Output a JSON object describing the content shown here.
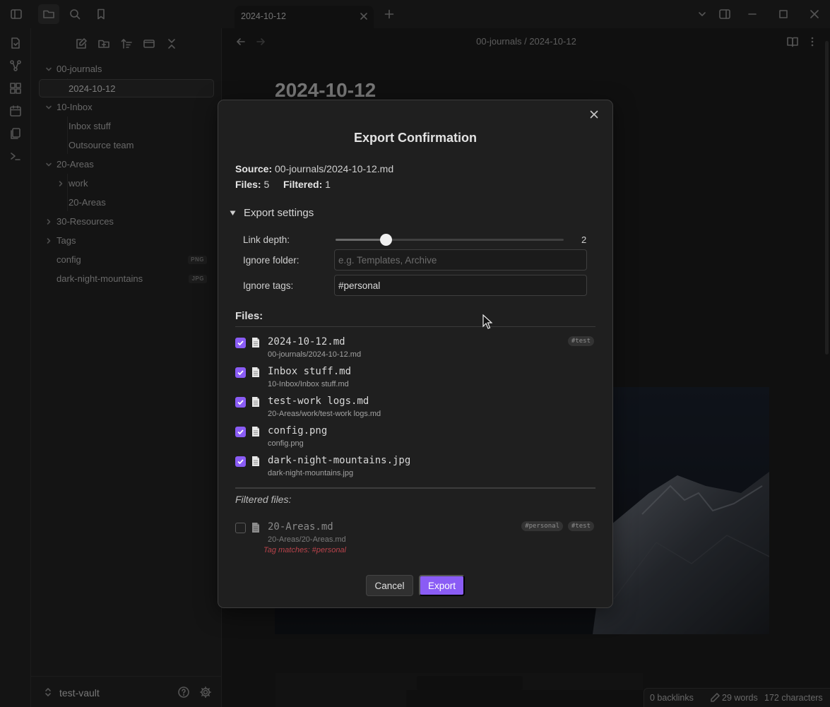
{
  "app": {
    "accent": "#8a5cf5"
  },
  "titlebar": {
    "tab_title": "2024-10-12",
    "icons": [
      "sidebar-toggle-icon",
      "folder-icon",
      "search-icon",
      "bookmark-icon",
      "close-icon",
      "plus-icon",
      "chevron-down-icon",
      "right-sidebar-icon",
      "minimize-icon",
      "maximize-icon",
      "close-icon"
    ]
  },
  "ribbon": {
    "icons": [
      "file-switcher-icon",
      "graph-icon",
      "canvas-icon",
      "calendar-icon",
      "templates-icon",
      "terminal-icon"
    ]
  },
  "sidebar": {
    "toolbar_icons": [
      "new-note-icon",
      "new-folder-icon",
      "sort-icon",
      "collapse-icon",
      "close-all-icon"
    ],
    "tree": [
      {
        "label": "00-journals",
        "type": "folder",
        "expanded": true
      },
      {
        "label": "2024-10-12",
        "type": "file",
        "selected": true
      },
      {
        "label": "10-Inbox",
        "type": "folder",
        "expanded": true
      },
      {
        "label": "Inbox stuff",
        "type": "file"
      },
      {
        "label": "Outsource team",
        "type": "file"
      },
      {
        "label": "20-Areas",
        "type": "folder",
        "expanded": true
      },
      {
        "label": "work",
        "type": "folder",
        "expanded": false
      },
      {
        "label": "20-Areas",
        "type": "file"
      },
      {
        "label": "30-Resources",
        "type": "folder",
        "expanded": false
      },
      {
        "label": "Tags",
        "type": "folder",
        "expanded": false
      },
      {
        "label": "config",
        "type": "file",
        "badge": "PNG"
      },
      {
        "label": "dark-night-mountains",
        "type": "file",
        "badge": "JPG"
      }
    ],
    "vault_name": "test-vault"
  },
  "main": {
    "breadcrumb": "00-journals / 2024-10-12",
    "note_title": "2024-10-12",
    "status": {
      "backlinks": "0 backlinks",
      "words": "29 words",
      "characters": "172 characters"
    }
  },
  "modal": {
    "title": "Export Confirmation",
    "source_label": "Source:",
    "source_value": "00-journals/2024-10-12.md",
    "files_label": "Files:",
    "files_count": "5",
    "filtered_label": "Filtered:",
    "filtered_count": "1",
    "settings_toggle": "Export settings",
    "link_depth_label": "Link depth:",
    "link_depth_value": "2",
    "link_depth_fraction": 0.22,
    "ignore_folder_label": "Ignore folder:",
    "ignore_folder_placeholder": "e.g. Templates, Archive",
    "ignore_folder_value": "",
    "ignore_tags_label": "Ignore tags:",
    "ignore_tags_value": "#personal",
    "files_heading": "Files:",
    "files": [
      {
        "name": "2024-10-12.md",
        "path": "00-journals/2024-10-12.md",
        "checked": true,
        "tags": [
          "#test"
        ]
      },
      {
        "name": "Inbox stuff.md",
        "path": "10-Inbox/Inbox stuff.md",
        "checked": true,
        "tags": []
      },
      {
        "name": "test-work logs.md",
        "path": "20-Areas/work/test-work logs.md",
        "checked": true,
        "tags": []
      },
      {
        "name": "config.png",
        "path": "config.png",
        "checked": true,
        "tags": []
      },
      {
        "name": "dark-night-mountains.jpg",
        "path": "dark-night-mountains.jpg",
        "checked": true,
        "tags": []
      }
    ],
    "filtered_heading": "Filtered files:",
    "filtered_files": [
      {
        "name": "20-Areas.md",
        "path": "20-Areas/20-Areas.md",
        "checked": false,
        "tags": [
          "#personal",
          "#test"
        ],
        "reason": "Tag matches: #personal"
      }
    ],
    "cancel_label": "Cancel",
    "export_label": "Export"
  }
}
